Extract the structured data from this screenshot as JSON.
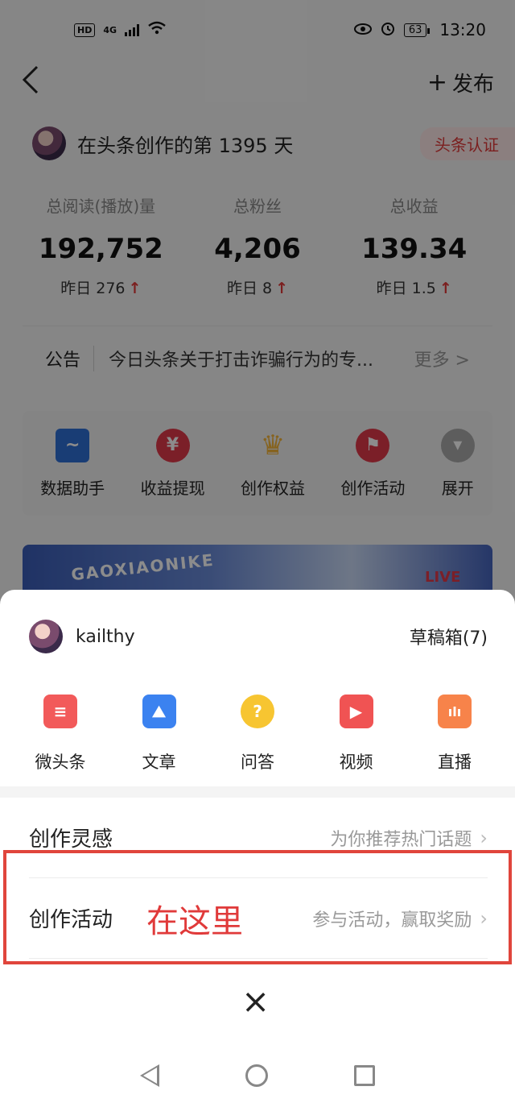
{
  "status_bar": {
    "hd": "HD",
    "network": "4G",
    "battery": "63",
    "time": "13:20"
  },
  "header": {
    "back_label": "<",
    "publish_plus": "+",
    "publish_label": "发布"
  },
  "creator": {
    "days_text": "在头条创作的第 1395 天",
    "badge": "头条认证"
  },
  "stats": [
    {
      "label": "总阅读(播放)量",
      "value": "192,752",
      "delta": "昨日 276"
    },
    {
      "label": "总粉丝",
      "value": "4,206",
      "delta": "昨日 8"
    },
    {
      "label": "总收益",
      "value": "139.34",
      "delta": "昨日 1.5"
    }
  ],
  "notice": {
    "label": "公告",
    "text": "今日头条关于打击诈骗行为的专...",
    "more": "更多 >"
  },
  "tools": [
    {
      "label": "数据助手",
      "icon": "chart-icon",
      "glyph": "~",
      "color": "#2f6fd6"
    },
    {
      "label": "收益提现",
      "icon": "yen-icon",
      "glyph": "¥",
      "color": "#e0394a"
    },
    {
      "label": "创作权益",
      "icon": "crown-icon",
      "glyph": "♛",
      "color": "#f5b53a"
    },
    {
      "label": "创作活动",
      "icon": "flag-icon",
      "glyph": "⚑",
      "color": "#e0394a"
    },
    {
      "label": "展开",
      "icon": "expand-icon",
      "glyph": "▾",
      "color": "#aaaaaa"
    }
  ],
  "banner": {
    "text": "GAOXIAONIKE",
    "live": "LIVE"
  },
  "sheet": {
    "username": "kailthy",
    "drafts": "草稿箱(7)",
    "types": [
      {
        "label": "微头条",
        "icon": "micro-headline-icon",
        "glyph": "≡",
        "color": "#f25a5a",
        "shape": "square"
      },
      {
        "label": "文章",
        "icon": "article-icon",
        "glyph": "⛰",
        "color": "#3b82f0",
        "shape": "square"
      },
      {
        "label": "问答",
        "icon": "qa-icon",
        "glyph": "?",
        "color": "#f7c531",
        "shape": "circle"
      },
      {
        "label": "视频",
        "icon": "video-icon",
        "glyph": "▶",
        "color": "#f05353",
        "shape": "square"
      },
      {
        "label": "直播",
        "icon": "live-icon",
        "glyph": "ılı",
        "color": "#f7834a",
        "shape": "square"
      }
    ],
    "inspiration": {
      "title": "创作灵感",
      "hint": "为你推荐热门话题"
    },
    "activity": {
      "title": "创作活动",
      "hint": "参与活动，赢取奖励"
    },
    "annotation": "在这里",
    "close": "×"
  }
}
